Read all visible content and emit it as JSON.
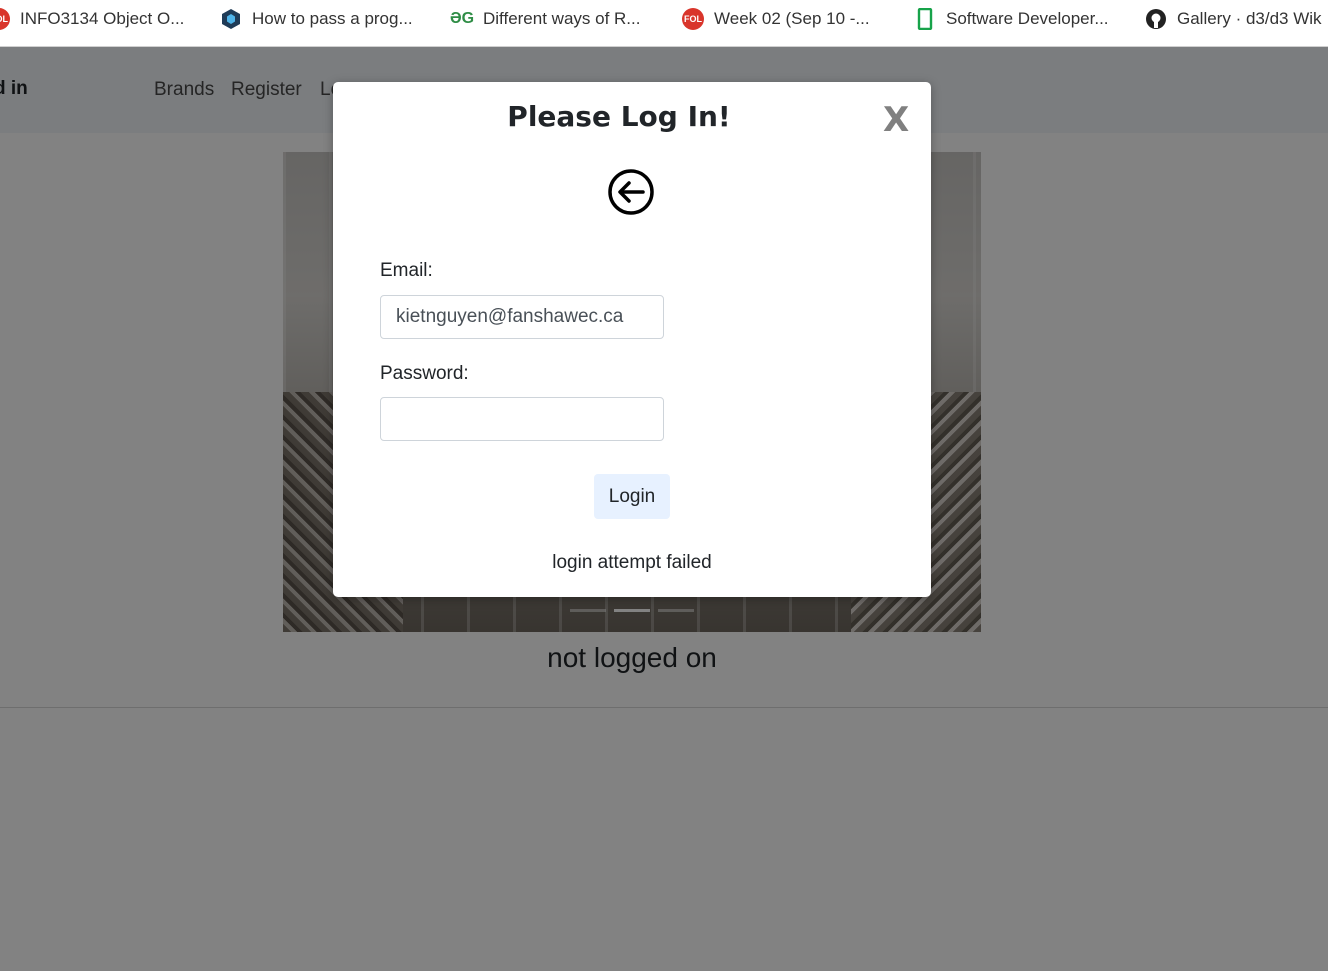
{
  "bookmarks": [
    {
      "label": "INFO3134 Object O...",
      "icon": "fol-icon"
    },
    {
      "label": "How to pass a prog...",
      "icon": "hexagon-icon"
    },
    {
      "label": "Different ways of R...",
      "icon": "geeksforgeeks-icon"
    },
    {
      "label": "Week 02 (Sep 10 -...",
      "icon": "fol-icon"
    },
    {
      "label": "Software Developer...",
      "icon": "phone-icon"
    },
    {
      "label": "Gallery · d3/d3 Wik",
      "icon": "github-icon"
    }
  ],
  "navbar": {
    "brand": "d in",
    "links": [
      "Brands",
      "Register",
      "Lo"
    ]
  },
  "page": {
    "status": "not logged on"
  },
  "modal": {
    "title": "Please Log In!",
    "close_label": "X",
    "email_label": "Email:",
    "email_value": "kietnguyen@fanshawec.ca",
    "password_label": "Password:",
    "password_value": "",
    "login_button": "Login",
    "message": "login attempt failed"
  },
  "colors": {
    "navbar_bg": "#f1f5fa",
    "login_button_bg": "#e7f1ff",
    "close_color": "#808080"
  }
}
